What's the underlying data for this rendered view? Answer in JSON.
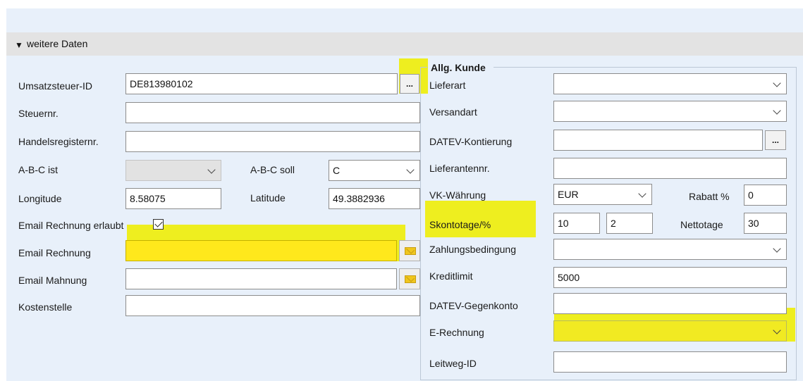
{
  "section": {
    "title": "weitere Daten",
    "expanded": true
  },
  "left": {
    "umsatzsteuer_label": "Umsatzsteuer-ID",
    "umsatzsteuer_value": "DE813980102",
    "umsatzsteuer_button": "...",
    "steuernr_label": "Steuernr.",
    "steuernr_value": "",
    "handelsregister_label": "Handelsregisternr.",
    "handelsregister_value": "",
    "abc_ist_label": "A-B-C ist",
    "abc_ist_value": "",
    "abc_soll_label": "A-B-C soll",
    "abc_soll_value": "C",
    "longitude_label": "Longitude",
    "longitude_value": "8.58075",
    "latitude_label": "Latitude",
    "latitude_value": "49.3882936",
    "email_erlaubt_label": "Email Rechnung erlaubt",
    "email_erlaubt_checked": true,
    "email_rechnung_label": "Email Rechnung",
    "email_rechnung_value": "",
    "email_mahnung_label": "Email Mahnung",
    "email_mahnung_value": "",
    "kostenstelle_label": "Kostenstelle",
    "kostenstelle_value": ""
  },
  "right": {
    "group_title": "Allg. Kunde",
    "lieferart_label": "Lieferart",
    "lieferart_value": "",
    "versandart_label": "Versandart",
    "versandart_value": "",
    "datev_kontierung_label": "DATEV-Kontierung",
    "datev_kontierung_value": "",
    "datev_kontierung_button": "...",
    "lieferantennr_label": "Lieferantennr.",
    "lieferantennr_value": "",
    "vk_waehrung_label": "VK-Währung",
    "vk_waehrung_value": "EUR",
    "rabatt_label": "Rabatt %",
    "rabatt_value": "0",
    "skontotage_label": "Skontotage/%",
    "skontotage_value": "10",
    "skonto_prozent_value": "2",
    "nettotage_label": "Nettotage",
    "nettotage_value": "30",
    "zahlungsbedingung_label": "Zahlungsbedingung",
    "zahlungsbedingung_value": "",
    "kreditlimit_label": "Kreditlimit",
    "kreditlimit_value": "5000",
    "datev_gegenkonto_label": "DATEV-Gegenkonto",
    "datev_gegenkonto_value": "",
    "e_rechnung_label": "E-Rechnung",
    "e_rechnung_value": "",
    "leitweg_label": "Leitweg-ID",
    "leitweg_value": ""
  },
  "colors": {
    "panel_background": "#e8f0fa",
    "header_background": "#e3e3e3",
    "highlight": "#eeee1f"
  },
  "icons": [
    "expand-triangle-icon",
    "chevron-down-icon",
    "mail-envelope-icon",
    "checkmark-icon"
  ]
}
